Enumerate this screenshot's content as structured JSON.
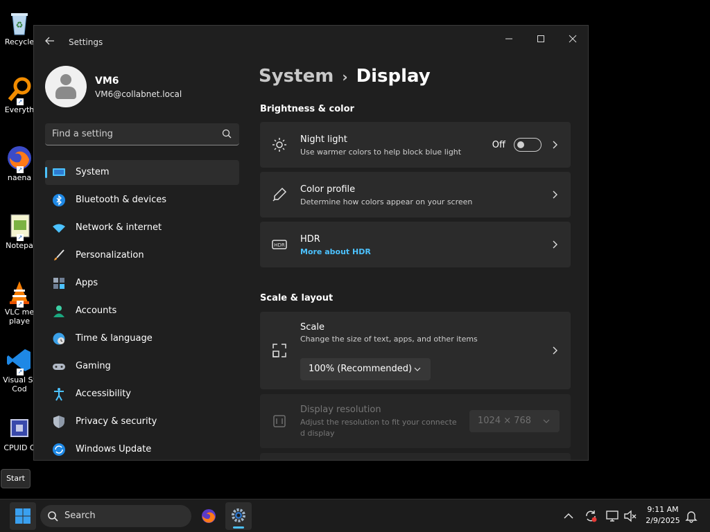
{
  "desktop": {
    "icons": [
      {
        "label": "Recycle",
        "icon": "recycle-bin-icon"
      },
      {
        "label": "Everyth",
        "icon": "everything-search-icon"
      },
      {
        "label": "naena",
        "icon": "firefox-icon"
      },
      {
        "label": "Notepa",
        "icon": "notepad-icon"
      },
      {
        "label": "VLC me\nplaye",
        "icon": "vlc-icon"
      },
      {
        "label": "Visual St\nCod",
        "icon": "vscode-icon"
      },
      {
        "label": "CPUID C",
        "icon": "cpuid-icon"
      }
    ]
  },
  "window": {
    "title": "Settings",
    "controls": {
      "minimize": "—",
      "maximize": "☐",
      "close": "✕"
    }
  },
  "profile": {
    "name": "VM6",
    "email": "VM6@collabnet.local"
  },
  "search": {
    "placeholder": "Find a setting"
  },
  "nav": {
    "items": [
      {
        "label": "System",
        "icon": "system-icon",
        "active": true
      },
      {
        "label": "Bluetooth & devices",
        "icon": "bluetooth-icon"
      },
      {
        "label": "Network & internet",
        "icon": "network-icon"
      },
      {
        "label": "Personalization",
        "icon": "brush-icon"
      },
      {
        "label": "Apps",
        "icon": "apps-icon"
      },
      {
        "label": "Accounts",
        "icon": "accounts-icon"
      },
      {
        "label": "Time & language",
        "icon": "time-language-icon"
      },
      {
        "label": "Gaming",
        "icon": "gaming-icon"
      },
      {
        "label": "Accessibility",
        "icon": "accessibility-icon"
      },
      {
        "label": "Privacy & security",
        "icon": "shield-icon"
      },
      {
        "label": "Windows Update",
        "icon": "windows-update-icon"
      }
    ]
  },
  "breadcrumb": {
    "parent": "System",
    "separator": "›",
    "current": "Display"
  },
  "sections": {
    "brightness": {
      "title": "Brightness & color",
      "night_light": {
        "title": "Night light",
        "desc": "Use warmer colors to help block blue light",
        "state": "Off"
      },
      "color_profile": {
        "title": "Color profile",
        "desc": "Determine how colors appear on your screen"
      },
      "hdr": {
        "title": "HDR",
        "link": "More about HDR"
      }
    },
    "scale_layout": {
      "title": "Scale & layout",
      "scale": {
        "title": "Scale",
        "desc": "Change the size of text, apps, and other items",
        "value": "100% (Recommended)"
      },
      "resolution": {
        "title": "Display resolution",
        "desc_line1": "Adjust the resolution to fit your connecte",
        "desc_line2": "d display",
        "value": "1024 × 768"
      }
    }
  },
  "start_tooltip": "Start",
  "taskbar": {
    "search_label": "Search",
    "clock_time": "9:11 AM",
    "clock_date": "2/9/2025"
  },
  "colors": {
    "accent": "#4cc2ff",
    "window_bg": "#1f1f1f",
    "card_bg": "#2b2b2b"
  }
}
